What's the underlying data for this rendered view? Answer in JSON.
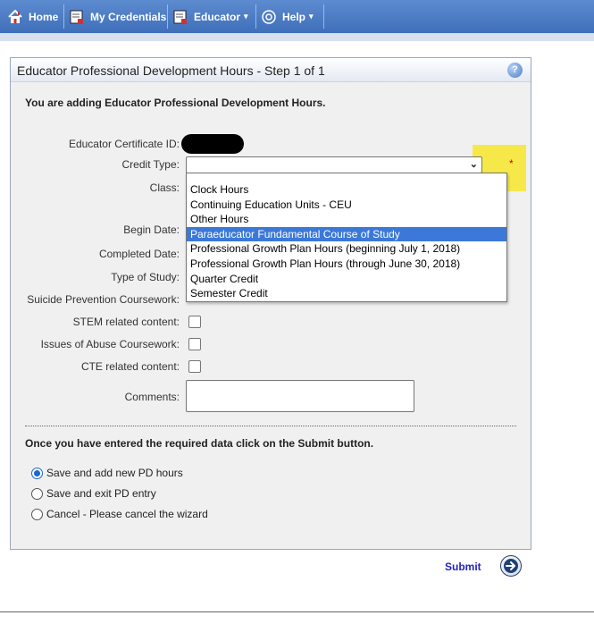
{
  "menu": {
    "home": "Home",
    "credentials": "My Credentials",
    "educator": "Educator",
    "help": "Help"
  },
  "panel": {
    "title": "Educator Professional Development Hours - Step 1 of 1",
    "help_icon": "?",
    "intro": "You are adding Educator Professional Development Hours."
  },
  "form": {
    "certificate_id_label": "Educator Certificate ID:",
    "credit_type_label": "Credit Type:",
    "credit_type_value": "",
    "required_marker": "*",
    "class_label": "Class:",
    "begin_date_label": "Begin Date:",
    "completed_date_label": "Completed Date:",
    "type_of_study_label": "Type of Study:",
    "suicide_label": "Suicide Prevention Coursework:",
    "stem_label": "STEM related content:",
    "abuse_label": "Issues of Abuse Coursework:",
    "cte_label": "CTE related content:",
    "comments_label": "Comments:",
    "comments_value": ""
  },
  "dropdown": {
    "options": [
      "Clock Hours",
      "Continuing Education Units - CEU",
      "Other Hours",
      "Paraeducator Fundamental Course of Study",
      "Professional Growth Plan Hours (beginning July 1, 2018)",
      "Professional Growth Plan Hours (through June 30, 2018)",
      "Quarter Credit",
      "Semester Credit"
    ],
    "highlighted": "Paraeducator Fundamental Course of Study"
  },
  "submit_section": {
    "instructions": "Once you have entered the required data click on the Submit button.",
    "radio_options": [
      {
        "label": "Save and add new PD hours",
        "selected": true
      },
      {
        "label": "Save and exit PD entry",
        "selected": false
      },
      {
        "label": "Cancel - Please cancel the wizard",
        "selected": false
      }
    ],
    "submit_label": "Submit"
  },
  "colors": {
    "menubar": "#4a7bc4",
    "highlight_yellow": "#f7e84a",
    "selected_option": "#3b78d8",
    "submit_link": "#2323c5"
  }
}
